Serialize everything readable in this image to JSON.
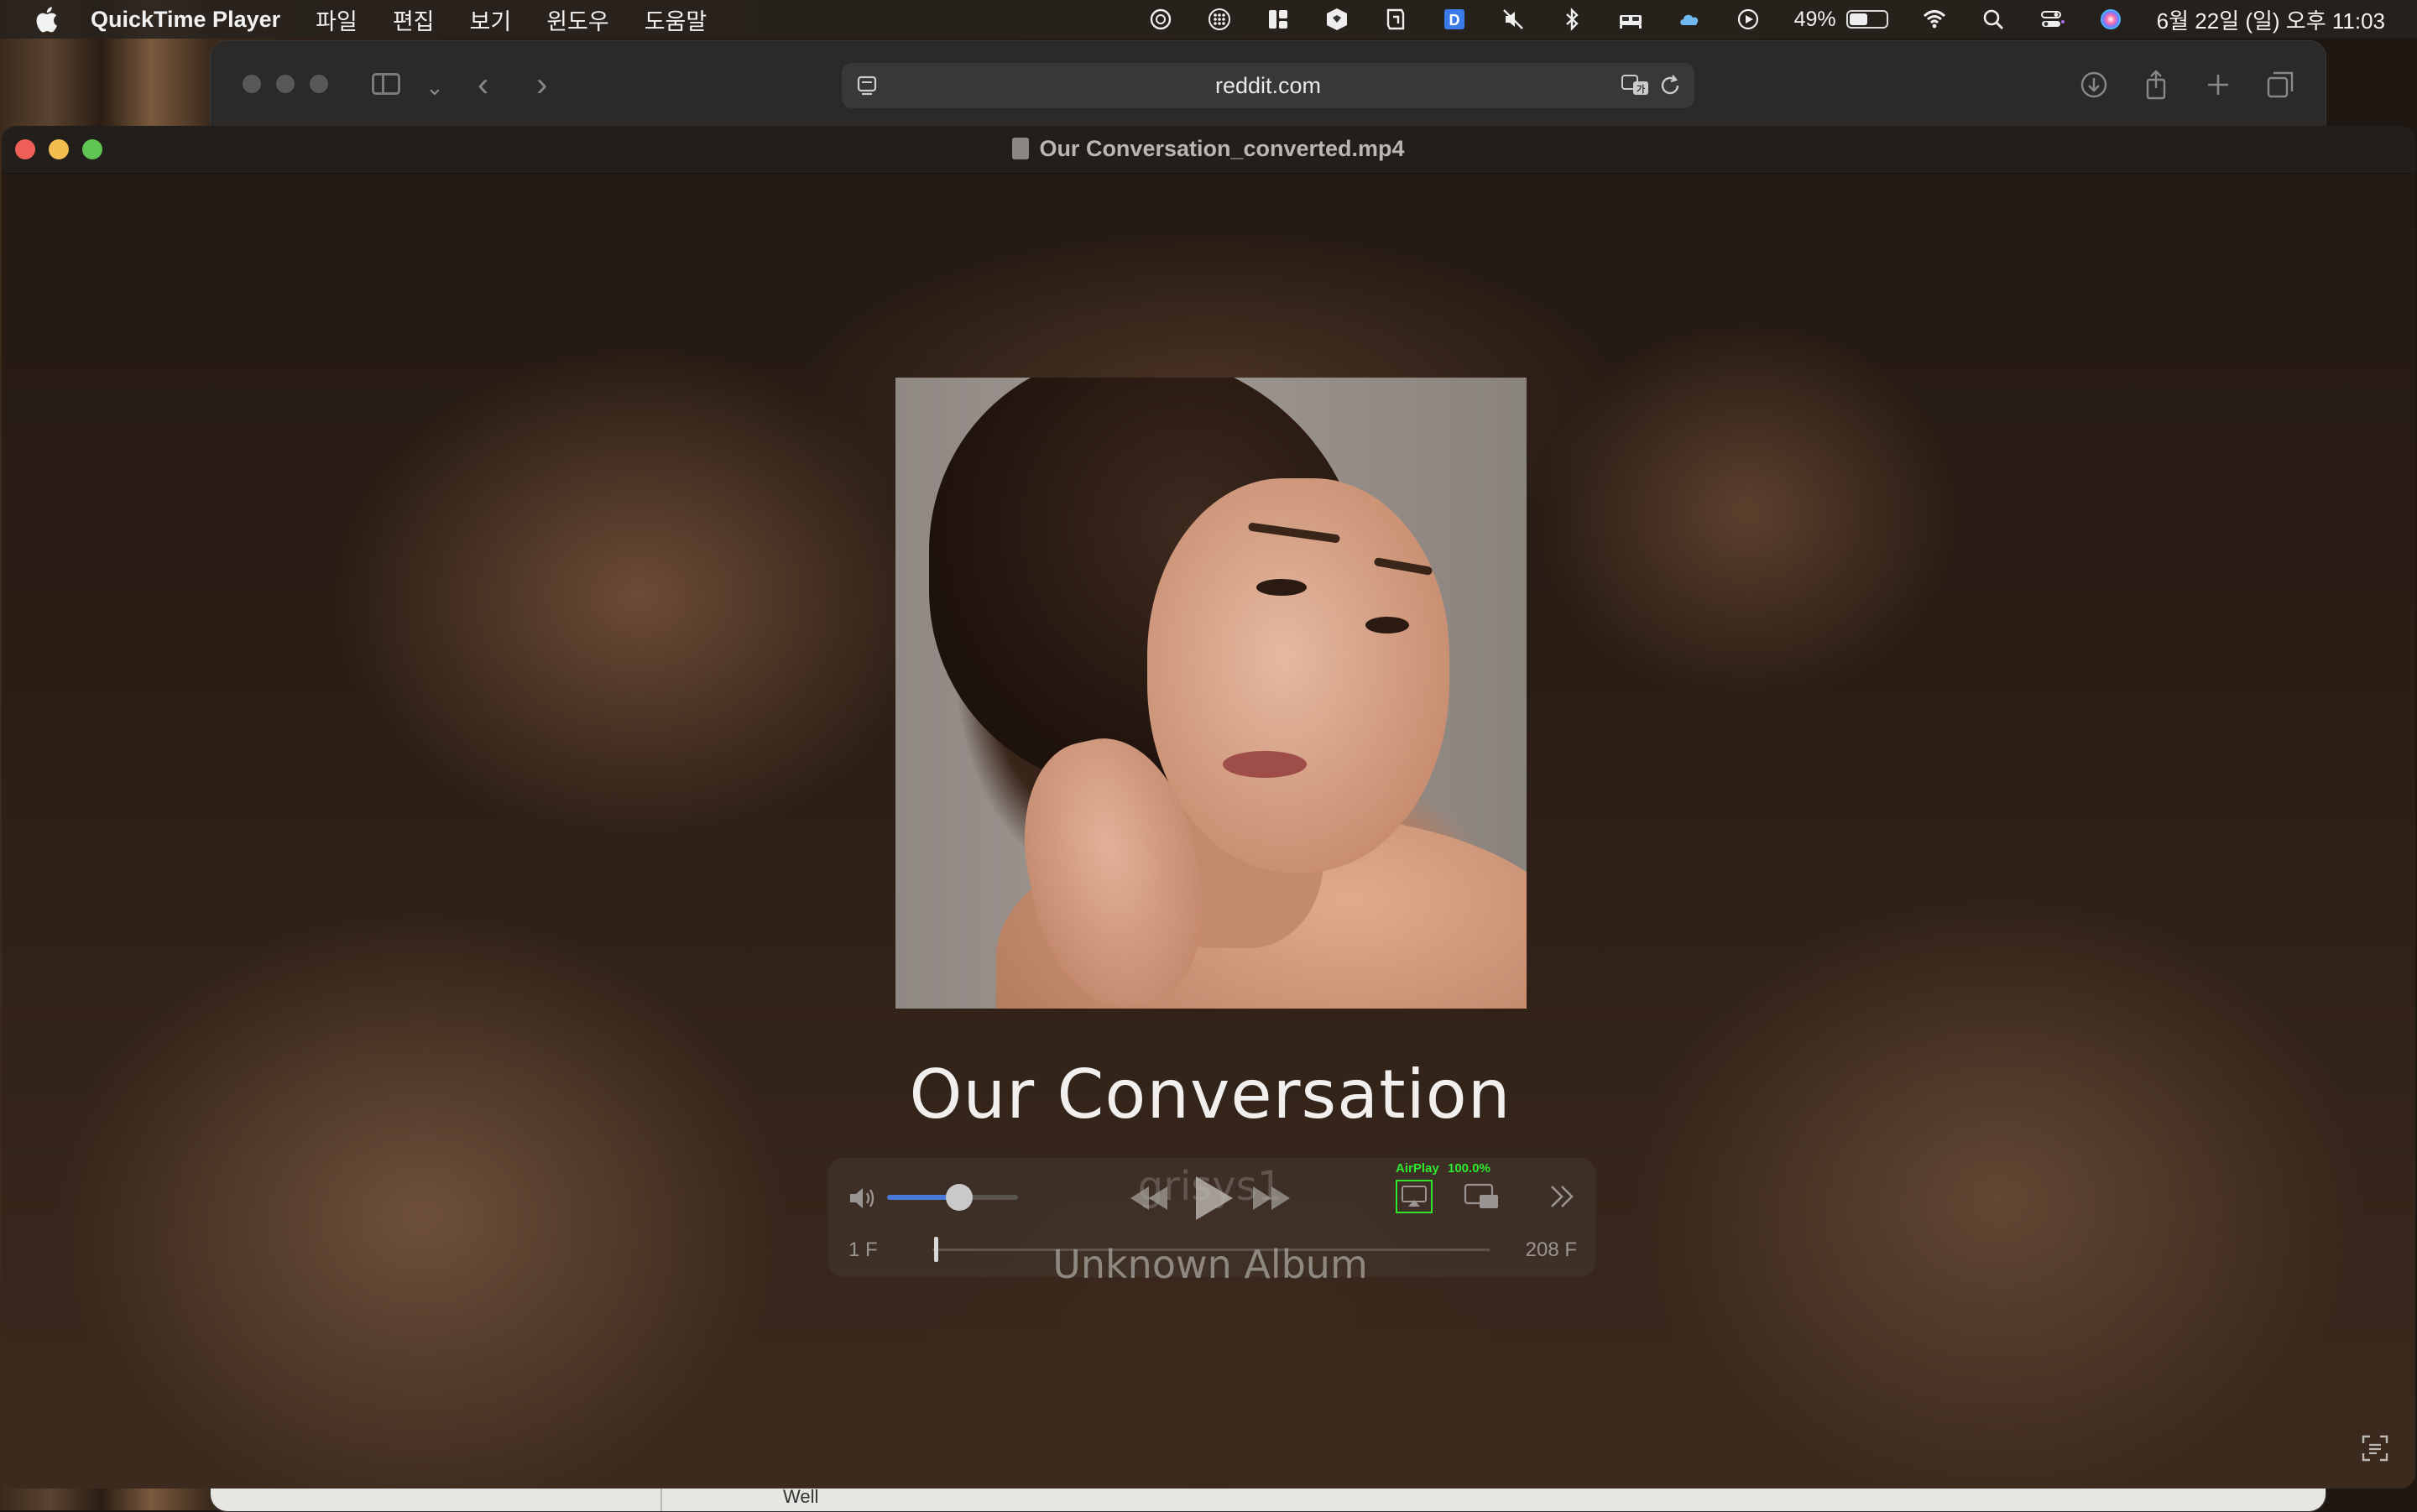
{
  "menubar": {
    "app_name": "QuickTime Player",
    "menus": [
      "파일",
      "편집",
      "보기",
      "윈도우",
      "도움말"
    ],
    "battery_percent": "49%",
    "battery_level": 0.49,
    "clock": "6월 22일 (일) 오후 11:03",
    "status_icons": [
      "chatgpt-icon",
      "grid-dots-icon",
      "layout-icon",
      "shield-icon",
      "vpn-icon",
      "dictionary-icon",
      "mute-icon",
      "bluetooth-icon",
      "bed-icon",
      "cloud-icon",
      "play-circle-icon",
      "battery-icon",
      "wifi-icon",
      "search-icon",
      "control-center-icon",
      "siri-icon"
    ]
  },
  "safari": {
    "address": "reddit.com",
    "status_label": "Well"
  },
  "quicktime": {
    "window_title": "Our Conversation_converted.mp4",
    "track": {
      "title": "Our Conversation",
      "artist": "grisys1",
      "album": "Unknown Album"
    },
    "controls": {
      "volume_level": 0.55,
      "airplay_label": "AirPlay",
      "speed_label": "100.0%",
      "frame_start": "1 F",
      "frame_end": "208 F",
      "scrub_position": 0.003
    }
  },
  "colors": {
    "accent_volume": "#4a7ad8",
    "airplay_green": "#2ee82e",
    "close": "#ed5f57",
    "minimize": "#f4bd4f",
    "maximize": "#5fc553"
  }
}
